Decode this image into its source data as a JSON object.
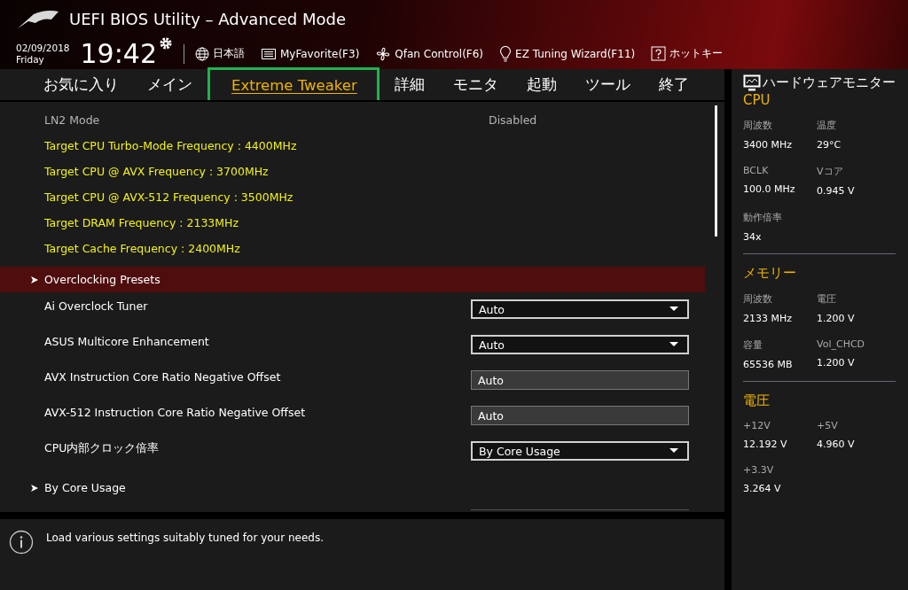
{
  "header": {
    "title": "UEFI BIOS Utility – Advanced Mode",
    "date": "02/09/2018",
    "day": "Friday",
    "time": "19:42",
    "toolbar": [
      {
        "kind": "globe",
        "label": "日本語"
      },
      {
        "kind": "favorite",
        "label": "MyFavorite(F3)"
      },
      {
        "kind": "fan",
        "label": "Qfan Control(F6)"
      },
      {
        "kind": "bulb",
        "label": "EZ Tuning Wizard(F11)"
      },
      {
        "kind": "help",
        "label": "ホットキー"
      }
    ]
  },
  "tabs": [
    {
      "label": "お気に入り",
      "selected": false,
      "highlighted": false
    },
    {
      "label": "メイン",
      "selected": false,
      "highlighted": false
    },
    {
      "label": "Extreme Tweaker",
      "selected": true,
      "highlighted": true
    },
    {
      "label": "詳細",
      "selected": false,
      "highlighted": false
    },
    {
      "label": "モニタ",
      "selected": false,
      "highlighted": false
    },
    {
      "label": "起動",
      "selected": false,
      "highlighted": false
    },
    {
      "label": "ツール",
      "selected": false,
      "highlighted": false
    },
    {
      "label": "終了",
      "selected": false,
      "highlighted": false
    }
  ],
  "settings": [
    {
      "kind": "info",
      "label": "LN2 Mode",
      "value": "Disabled"
    },
    {
      "kind": "target",
      "label": "Target CPU Turbo-Mode Frequency : 4400MHz"
    },
    {
      "kind": "target",
      "label": "Target CPU @ AVX Frequency : 3700MHz"
    },
    {
      "kind": "target",
      "label": "Target CPU @ AVX-512 Frequency : 3500MHz"
    },
    {
      "kind": "target",
      "label": "Target DRAM Frequency : 2133MHz"
    },
    {
      "kind": "target",
      "label": "Target Cache Frequency : 2400MHz"
    },
    {
      "kind": "submenu",
      "label": "Overclocking Presets",
      "selected": true
    },
    {
      "kind": "dropdown",
      "label": "Ai Overclock Tuner",
      "value": "Auto"
    },
    {
      "kind": "dropdown",
      "label": "ASUS Multicore Enhancement",
      "value": "Auto"
    },
    {
      "kind": "field",
      "label": "AVX Instruction Core Ratio Negative Offset",
      "value": "Auto"
    },
    {
      "kind": "field",
      "label": "AVX-512 Instruction Core Ratio Negative Offset",
      "value": "Auto"
    },
    {
      "kind": "dropdown",
      "label": "CPU内部クロック倍率",
      "value": "By Core Usage"
    },
    {
      "kind": "submenu",
      "label": "By Core Usage",
      "selected": false
    }
  ],
  "help": "Load various settings suitably tuned for your needs.",
  "monitor": {
    "title": "ハードウェアモニター",
    "sections": [
      {
        "title": "CPU",
        "items": [
          {
            "label": "周波数",
            "value": "3400 MHz"
          },
          {
            "label": "温度",
            "value": "29°C"
          },
          {
            "label": "BCLK",
            "value": "100.0 MHz"
          },
          {
            "label": "Vコア",
            "value": "0.945 V"
          },
          {
            "label": "動作倍率",
            "value": "34x"
          }
        ]
      },
      {
        "title": "メモリー",
        "items": [
          {
            "label": "周波数",
            "value": "2133 MHz"
          },
          {
            "label": "電圧",
            "value": "1.200 V"
          },
          {
            "label": "容量",
            "value": "65536 MB"
          },
          {
            "label": "Vol_CHCD",
            "value": "1.200 V"
          }
        ]
      },
      {
        "title": "電圧",
        "items": [
          {
            "label": "+12V",
            "value": "12.192 V"
          },
          {
            "label": "+5V",
            "value": "4.960 V"
          },
          {
            "label": "+3.3V",
            "value": "3.264 V"
          }
        ]
      }
    ]
  }
}
